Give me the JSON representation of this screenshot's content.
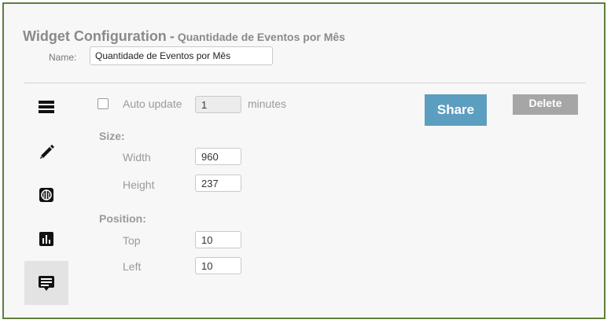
{
  "header": {
    "title": "Widget Configuration",
    "separator": "-",
    "subtitle": "Quantidade de Eventos por Mês"
  },
  "name_field": {
    "label": "Name:",
    "value": "Quantidade de Eventos por Mês"
  },
  "sidebar": {
    "icons": [
      {
        "name": "list-icon",
        "active": false
      },
      {
        "name": "pencil-icon",
        "active": false
      },
      {
        "name": "database-icon",
        "active": false
      },
      {
        "name": "bar-chart-icon",
        "active": false
      },
      {
        "name": "message-icon",
        "active": true
      }
    ]
  },
  "auto_update": {
    "checked": false,
    "label": "Auto update",
    "value": "1",
    "unit": "minutes"
  },
  "size": {
    "heading": "Size:",
    "width_label": "Width",
    "width_value": "960",
    "height_label": "Height",
    "height_value": "237"
  },
  "position": {
    "heading": "Position:",
    "top_label": "Top",
    "top_value": "10",
    "left_label": "Left",
    "left_value": "10"
  },
  "actions": {
    "share_label": "Share",
    "delete_label": "Delete"
  },
  "colors": {
    "frame_border": "#5e7f3a",
    "share_button": "#5b9ec0",
    "delete_button": "#a6a6a6",
    "text_gray": "#8a8a8a"
  }
}
